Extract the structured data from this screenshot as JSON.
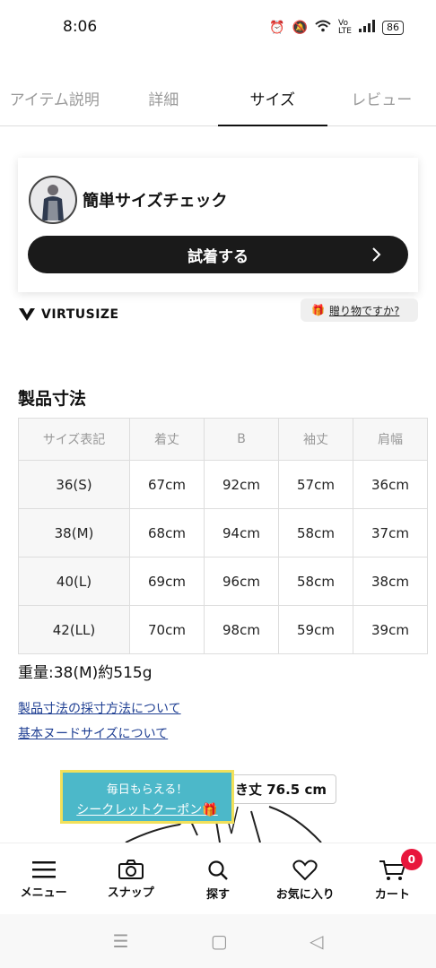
{
  "status": {
    "time": "8:06",
    "battery": "86"
  },
  "tabs": [
    {
      "label": "アイテム説明"
    },
    {
      "label": "詳細"
    },
    {
      "label": "サイズ"
    },
    {
      "label": "レビュー"
    }
  ],
  "size_check": {
    "title": "簡単サイズチェック",
    "button_label": "試着する"
  },
  "virtusize": {
    "brand": "VIRTUSIZE"
  },
  "gift": {
    "label": "贈り物ですか?"
  },
  "product_dimensions": {
    "title": "製品寸法",
    "headers": [
      "サイズ表記",
      "着丈",
      "B",
      "袖丈",
      "肩幅"
    ],
    "rows": [
      [
        "36(S)",
        "67cm",
        "92cm",
        "57cm",
        "36cm"
      ],
      [
        "38(M)",
        "68cm",
        "94cm",
        "58cm",
        "37cm"
      ],
      [
        "40(L)",
        "69cm",
        "96cm",
        "58cm",
        "38cm"
      ],
      [
        "42(LL)",
        "70cm",
        "98cm",
        "59cm",
        "39cm"
      ]
    ],
    "weight": "重量:38(M)約515g",
    "link_measure": "製品寸法の採寸方法について",
    "link_nude": "基本ヌードサイズについて"
  },
  "measurement": {
    "label": "ゆき丈 76.5 cm"
  },
  "coupon": {
    "line1": "毎日もらえる！",
    "line2": "シークレットクーポン🎁"
  },
  "bottom_nav": [
    {
      "label": "メニュー"
    },
    {
      "label": "スナップ"
    },
    {
      "label": "探す"
    },
    {
      "label": "お気に入り"
    },
    {
      "label": "カート"
    }
  ],
  "cart_badge": "0"
}
